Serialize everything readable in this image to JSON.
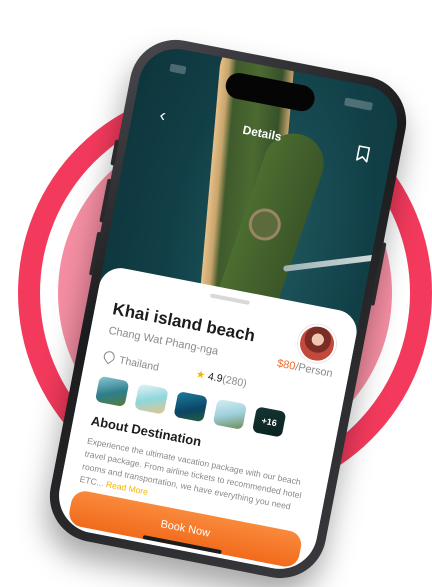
{
  "header": {
    "title": "Details",
    "back_icon": "chevron-left-icon",
    "bookmark_icon": "bookmark-icon"
  },
  "place": {
    "name": "Khai island beach",
    "location": "Chang Wat Phang-nga",
    "price": "$80",
    "price_unit": "/Person",
    "country": "Thailand",
    "rating": "4.9",
    "rating_count": "(280)"
  },
  "gallery": {
    "more_label": "+16"
  },
  "about": {
    "title": "About Destination",
    "text": "Experience the ultimate vacation package with our beach travel package. From airline tickets to recommended hotel rooms and transportation, we have everything you need ETC...",
    "read_more": "Read More"
  },
  "actions": {
    "book_label": "Book Now"
  },
  "colors": {
    "accent": "#f26b2a",
    "star": "#f5b400",
    "ring": "#f33a5c",
    "ring_inner": "#f58ea3"
  }
}
